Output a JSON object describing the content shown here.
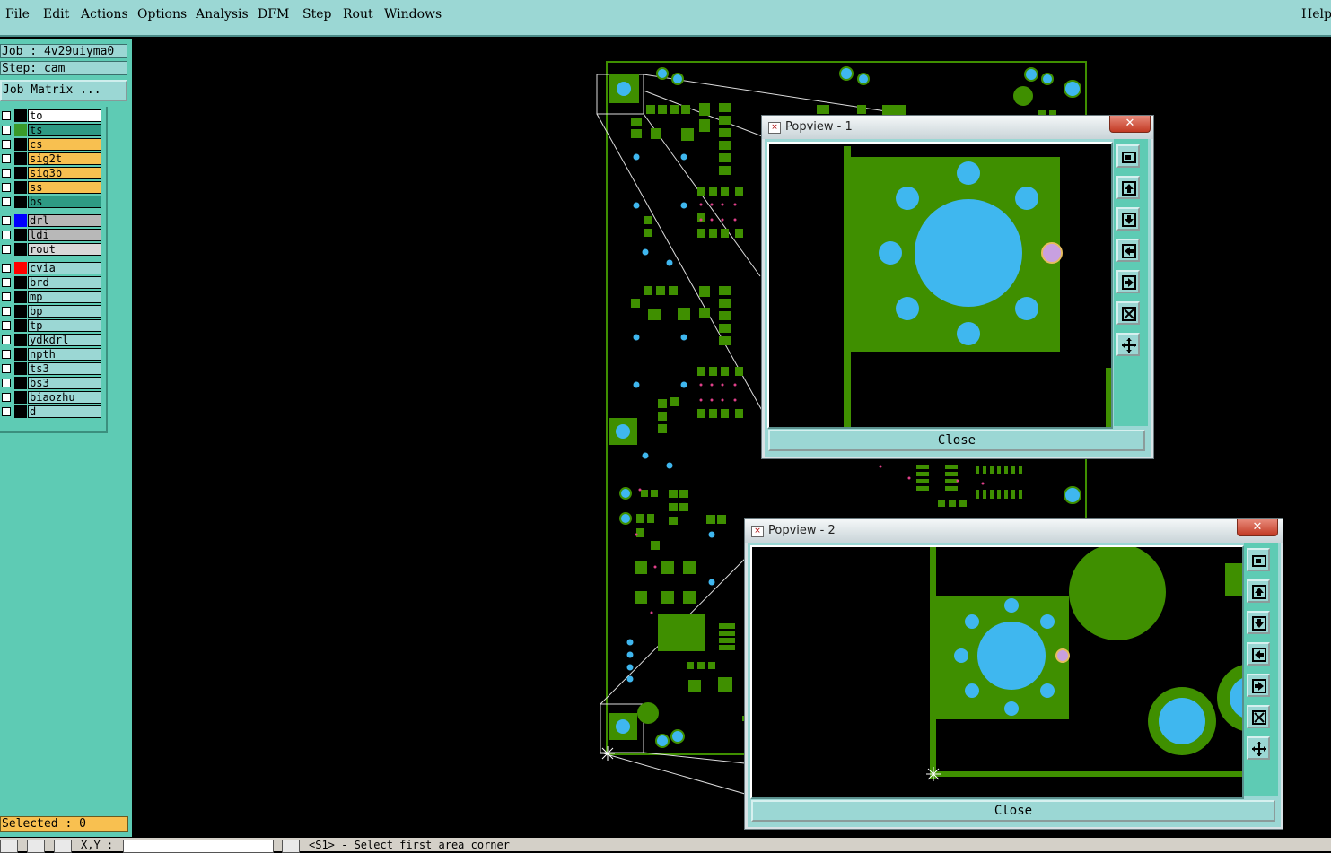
{
  "menubar": {
    "items": [
      "File",
      "Edit",
      "Actions",
      "Options",
      "Analysis",
      "DFM",
      "Step",
      "Rout",
      "Windows"
    ],
    "help": "Help"
  },
  "job": {
    "job_label": "Job : 4v29uiyma0",
    "step_label": "Step: cam",
    "matrix_button": "Job Matrix ..."
  },
  "layers": [
    {
      "name": "to",
      "color": "#000000",
      "name_bg": "#ffffff"
    },
    {
      "name": "ts",
      "color": "#3a9a2a",
      "name_bg": "#2e9a84"
    },
    {
      "name": "cs",
      "color": "#000000",
      "name_bg": "#f8c050"
    },
    {
      "name": "sig2t",
      "color": "#000000",
      "name_bg": "#f8c050"
    },
    {
      "name": "sig3b",
      "color": "#000000",
      "name_bg": "#f8c050"
    },
    {
      "name": "ss",
      "color": "#000000",
      "name_bg": "#f8c050"
    },
    {
      "name": "bs",
      "color": "#000000",
      "name_bg": "#2e9a84"
    },
    {
      "name": "drl",
      "color": "#0000ff",
      "name_bg": "#b8b8b8"
    },
    {
      "name": "ldi",
      "color": "#000000",
      "name_bg": "#b8b8b8"
    },
    {
      "name": "rout",
      "color": "#000000",
      "name_bg": "#d8d8d8"
    },
    {
      "name": "cvia",
      "color": "#ff0000",
      "name_bg": "#9bd7d4"
    },
    {
      "name": "brd",
      "color": "#000000",
      "name_bg": "#9bd7d4"
    },
    {
      "name": "mp",
      "color": "#000000",
      "name_bg": "#9bd7d4"
    },
    {
      "name": "bp",
      "color": "#000000",
      "name_bg": "#9bd7d4"
    },
    {
      "name": "tp",
      "color": "#000000",
      "name_bg": "#9bd7d4"
    },
    {
      "name": "ydkdrl",
      "color": "#000000",
      "name_bg": "#9bd7d4"
    },
    {
      "name": "npth",
      "color": "#000000",
      "name_bg": "#9bd7d4"
    },
    {
      "name": "ts3",
      "color": "#000000",
      "name_bg": "#9bd7d4"
    },
    {
      "name": "bs3",
      "color": "#000000",
      "name_bg": "#9bd7d4"
    },
    {
      "name": "biaozhu",
      "color": "#000000",
      "name_bg": "#9bd7d4"
    },
    {
      "name": "d",
      "color": "#000000",
      "name_bg": "#9bd7d4"
    }
  ],
  "selected": "Selected : 0",
  "status": {
    "xy_label": "X,Y :",
    "message": "<S1> - Select first area corner"
  },
  "popview1": {
    "title": "Popview - 1",
    "close_x": "✕",
    "close_button": "Close"
  },
  "popview2": {
    "title": "Popview - 2",
    "close_x": "✕",
    "close_button": "Close"
  },
  "colors": {
    "copper": "#3f8f00",
    "pad": "#3fb7ef",
    "via_drill": "#c8a0e0",
    "panel": "#5ecbb4",
    "bar": "#9bd7d4"
  },
  "tool_icons": [
    "zoom-window-icon",
    "pan-up-icon",
    "pan-down-icon",
    "pan-left-icon",
    "pan-right-icon",
    "zoom-fit-icon",
    "zoom-home-icon"
  ]
}
